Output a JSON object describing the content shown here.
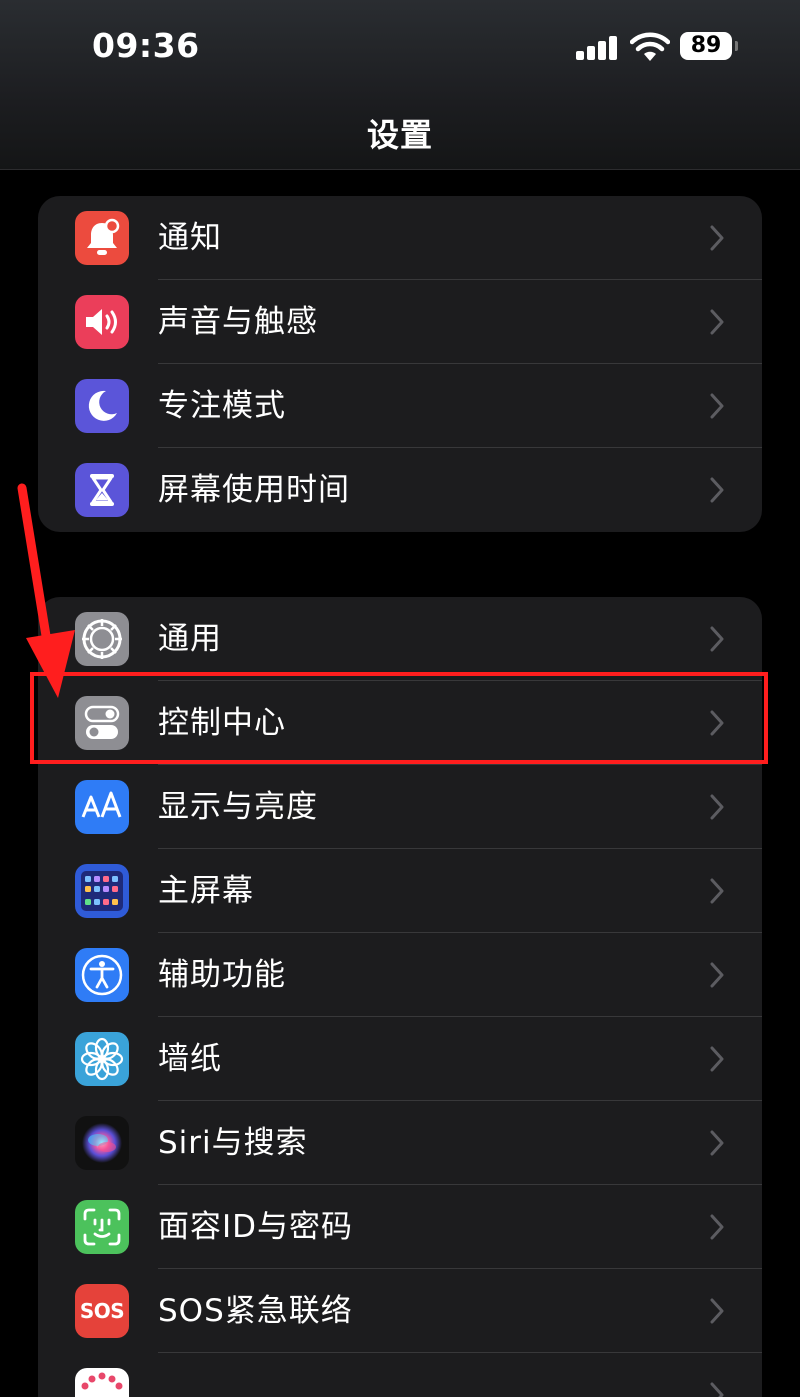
{
  "status_bar": {
    "time": "09:36",
    "battery": "89"
  },
  "nav": {
    "title": "设置"
  },
  "groups": [
    [
      {
        "label": "通知",
        "icon": "notification-bell-icon",
        "color": "#ec4b3e"
      },
      {
        "label": "声音与触感",
        "icon": "speaker-icon",
        "color": "#eb3e5a"
      },
      {
        "label": "专注模式",
        "icon": "moon-icon",
        "color": "#5b55d9"
      },
      {
        "label": "屏幕使用时间",
        "icon": "hourglass-icon",
        "color": "#5b55d9"
      }
    ],
    [
      {
        "label": "通用",
        "icon": "gear-icon",
        "color": "#8e8e93"
      },
      {
        "label": "控制中心",
        "icon": "toggle-switches-icon",
        "color": "#8e8e93"
      },
      {
        "label": "显示与亮度",
        "icon": "text-size-icon",
        "color": "#2f7cf6"
      },
      {
        "label": "主屏幕",
        "icon": "home-screen-grid-icon",
        "color": "#2f5bd8"
      },
      {
        "label": "辅助功能",
        "icon": "accessibility-person-icon",
        "color": "#2f7cf6"
      },
      {
        "label": "墙纸",
        "icon": "flower-icon",
        "color": "#3aa3d9"
      },
      {
        "label": "Siri与搜索",
        "icon": "siri-icon",
        "color": "#1a1a1a"
      },
      {
        "label": "面容ID与密码",
        "icon": "face-id-icon",
        "color": "#4cc25c"
      },
      {
        "label": "SOS紧急联络",
        "icon": "sos-icon",
        "color": "#e5423a",
        "icon_text": "SOS"
      },
      {
        "label": "",
        "icon": "exposure-dots-icon",
        "color": "#ffffff"
      }
    ]
  ],
  "annotation": {
    "color": "#ff1e1e"
  }
}
